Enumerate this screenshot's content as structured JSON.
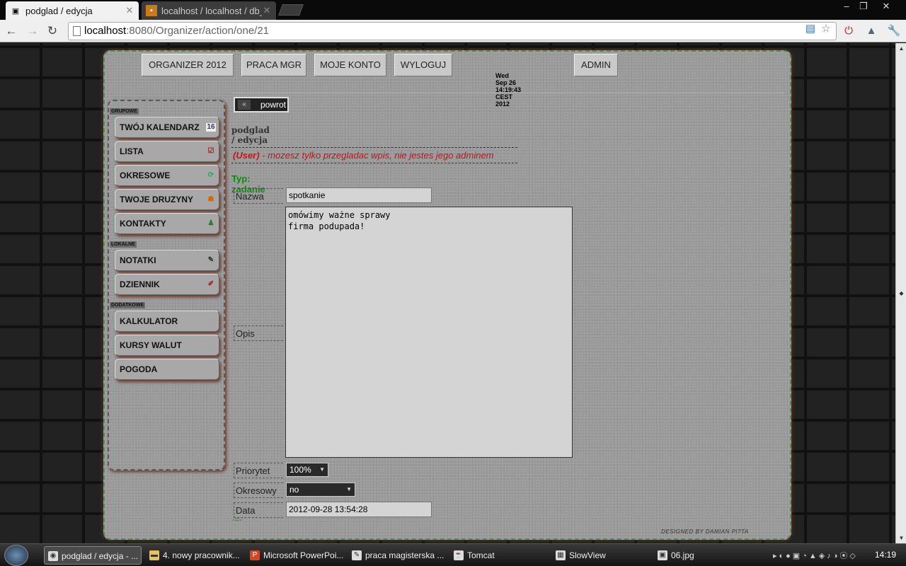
{
  "browser": {
    "tabs": [
      {
        "title": "podglad / edycja",
        "icon": "page-favicon"
      },
      {
        "title": "localhost / localhost / db_",
        "icon": "phpmyadmin-favicon"
      }
    ],
    "url": {
      "host": "localhost",
      "rest": ":8080/Organizer/action/one/21"
    }
  },
  "nav": {
    "items": [
      "ORGANIZER 2012",
      "PRACA MGR",
      "MOJE KONTO",
      "WYLOGUJ",
      "ADMIN"
    ],
    "datetime": "Wed Sep 26 14:19:43 CEST 2012"
  },
  "sidebar": {
    "sections": [
      "GRUPOWE",
      "LOKALNE",
      "DODATKOWE"
    ],
    "groupowe": [
      "TWÓJ KALENDARZ",
      "LISTA",
      "OKRESOWE",
      "TWOJE DRUZYNY",
      "KONTAKTY"
    ],
    "lokalne": [
      "NOTATKI",
      "DZIENNIK"
    ],
    "dodatkowe": [
      "KALKULATOR",
      "KURSY WALUT",
      "POGODA"
    ]
  },
  "content": {
    "back_label": "powrot",
    "page_title": "podglad / edycja",
    "warning_role": "(User)",
    "warning_text": " - mozesz tylko przegladac wpis, nie jestes jego adminem",
    "type_line": "Typ: zadanie",
    "fields": {
      "nazwa_label": "Nazwa",
      "nazwa_value": "spotkanie",
      "opis_label": "Opis",
      "opis_value": "omówimy ważne sprawy\nfirma podupada!",
      "priorytet_label": "Priorytet",
      "priorytet_value": "100%",
      "okresowy_label": "Okresowy",
      "okresowy_value": "no",
      "data_label": "Data",
      "data_value": "2012-09-28 13:54:28"
    },
    "footer_mark": "-=-",
    "designer": "DESIGNED BY DAMIAN PI?TA"
  },
  "taskbar": {
    "tasks": [
      "podglad / edycja - ...",
      "4. nowy pracownik...",
      "Microsoft PowerPoi...",
      "praca magisterska ...",
      "Tomcat",
      "SlowView",
      "06.jpg"
    ],
    "time": "14:19"
  }
}
